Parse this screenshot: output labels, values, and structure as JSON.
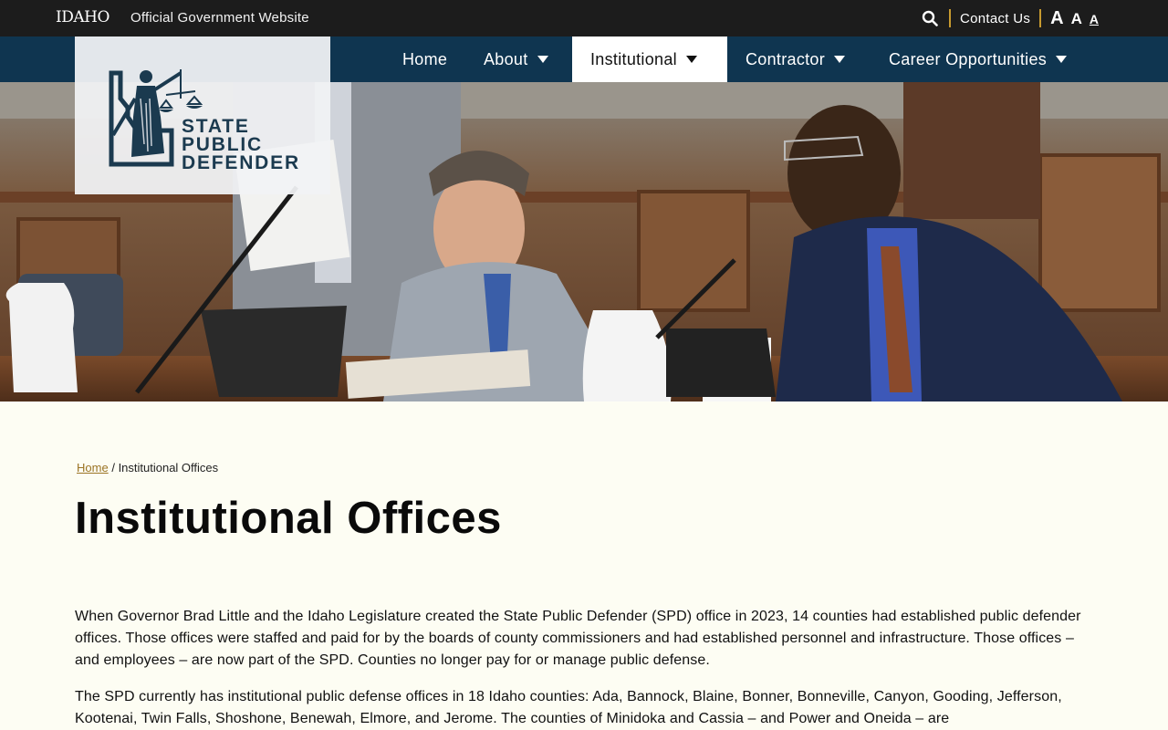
{
  "topbar": {
    "logo": "IDAHO",
    "official_label": "Official Government Website",
    "contact_label": "Contact Us",
    "font_sizes": [
      "A",
      "A",
      "A"
    ]
  },
  "nav": {
    "items": [
      {
        "label": "Home",
        "has_menu": false
      },
      {
        "label": "About",
        "has_menu": true
      },
      {
        "label": "Institutional",
        "has_menu": true,
        "active": true
      },
      {
        "label": "Contractor",
        "has_menu": true
      },
      {
        "label": "Career Opportunities",
        "has_menu": true
      }
    ]
  },
  "logo": {
    "line1": "STATE",
    "line2": "PUBLIC",
    "line3": "DEFENDER"
  },
  "breadcrumb": {
    "home": "Home",
    "separator": "/",
    "current": "Institutional Offices"
  },
  "page": {
    "title": "Institutional Offices",
    "paragraphs": [
      "When Governor Brad Little and the Idaho Legislature created the State Public Defender (SPD) office in 2023, 14 counties had established public defender offices. Those offices were staffed and paid for by the boards of county commissioners and had established personnel and infrastructure. Those offices – and employees – are now part of the SPD. Counties no longer pay for or manage public defense.",
      "The SPD currently has institutional public defense offices in 18 Idaho counties: Ada, Bannock, Blaine, Bonner, Bonneville, Canyon, Gooding, Jefferson, Kootenai, Twin Falls, Shoshone, Benewah, Elmore, and Jerome. The counties of Minidoka and Cassia – and Power and Oneida – are"
    ]
  },
  "colors": {
    "topbar": "#1c1c1c",
    "nav": "#0f3550",
    "accent_gold": "#c79a2f",
    "page_bg": "#fdfdf3",
    "logo_navy": "#1b3a4f"
  }
}
